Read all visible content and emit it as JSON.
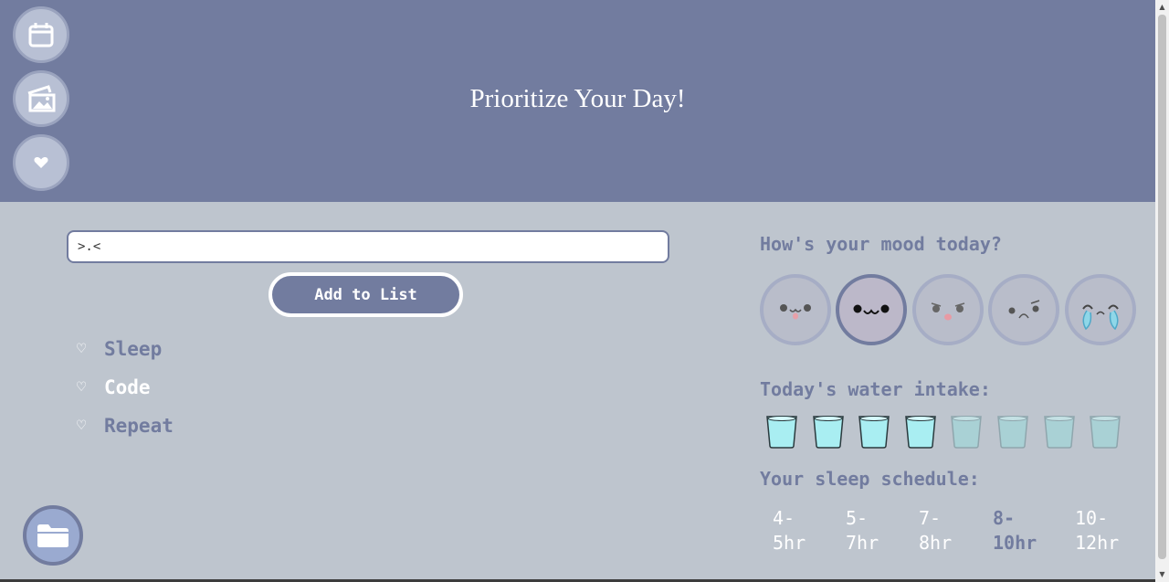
{
  "header": {
    "title": "Prioritize Your Day!"
  },
  "nav": [
    {
      "icon": "calendar-icon"
    },
    {
      "icon": "image-gallery-icon"
    },
    {
      "icon": "heart-icon"
    }
  ],
  "task_input": {
    "value": ">.<"
  },
  "add_button": {
    "label": "Add to List"
  },
  "tasks": [
    {
      "label": "Sleep",
      "active": false
    },
    {
      "label": "Code",
      "active": true
    },
    {
      "label": "Repeat",
      "active": false
    }
  ],
  "mood": {
    "title": "How's your mood today?",
    "options": [
      "happy-face-icon",
      "content-face-icon",
      "sad-face-icon",
      "upset-face-icon",
      "crying-face-icon"
    ],
    "selected_index": 1
  },
  "water": {
    "title": "Today's water intake:",
    "total_glasses": 8,
    "filled_glasses": 4
  },
  "sleep": {
    "title": "Your sleep schedule:",
    "options": [
      {
        "line1": "4-",
        "line2": "5hr"
      },
      {
        "line1": "5-",
        "line2": "7hr"
      },
      {
        "line1": "7-",
        "line2": "8hr"
      },
      {
        "line1": "8-",
        "line2": "10hr"
      },
      {
        "line1": "10-",
        "line2": "12hr"
      }
    ],
    "selected_index": 3
  },
  "folder_button": {
    "icon": "folder-icon"
  },
  "colors": {
    "header": "#727c9f",
    "background": "#bec5ce",
    "accent": "#727c9f",
    "water": "#a9eef2"
  }
}
